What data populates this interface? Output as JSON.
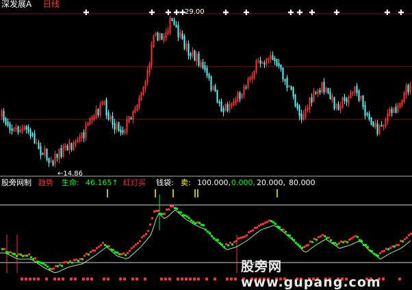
{
  "header": {
    "stock_name": "深发展A",
    "period": "日线"
  },
  "price_panel": {
    "high_label": "29.00",
    "low_label": "14.86"
  },
  "indicator_bar": {
    "name": "股旁网制",
    "trend_label": "趋势",
    "life_label": "生命:",
    "life_value": "46.165↑",
    "red_buy": "红灯买",
    "money_bag": "钱袋:",
    "sell": "卖:",
    "val1": "100.000,",
    "val2": "0.000,",
    "val3": "20.000,",
    "val4": "80.000"
  },
  "watermark": {
    "text": "股旁网 www.gupang.com"
  },
  "colors": {
    "background": "#000000",
    "up_candle": "#ff3232",
    "down_candle": "#54fcfc",
    "ma_line": "#a0f0a0",
    "panel_divider": "#c0c0c0",
    "ind_yellow": "#ffff00",
    "ind_green": "#00ff00",
    "ind_red": "#ff3232"
  }
}
